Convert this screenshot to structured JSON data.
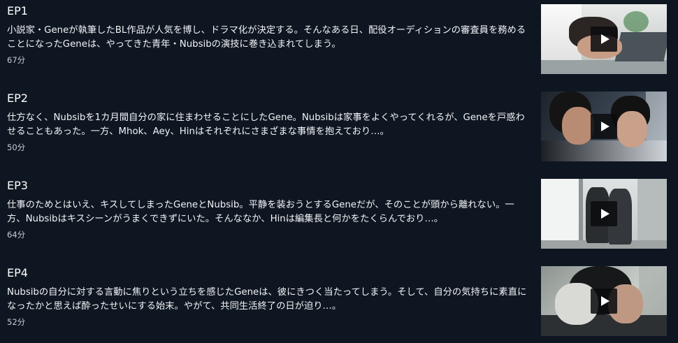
{
  "episodes": [
    {
      "title": "EP1",
      "description": "小説家・Geneが執筆したBL作品が人気を博し、ドラマ化が決定する。そんなある日、配役オーディションの審査員を務めることになったGeneは、やってきた青年・Nubsibの演技に巻き込まれてしまう。",
      "duration": "67分",
      "thumbnail_icon": "play-icon"
    },
    {
      "title": "EP2",
      "description": "仕方なく、Nubsibを1カ月間自分の家に住まわせることにしたGene。Nubsibは家事をよくやってくれるが、Geneを戸惑わせることもあった。一方、Mhok、Aey、Hinはそれぞれにさまざまな事情を抱えており…。",
      "duration": "50分",
      "thumbnail_icon": "play-icon"
    },
    {
      "title": "EP3",
      "description": "仕事のためとはいえ、キスしてしまったGeneとNubsib。平静を装おうとするGeneだが、そのことが頭から離れない。一方、Nubsibはキスシーンがうまくできずにいた。そんななか、Hinは編集長と何かをたくらんでおり…。",
      "duration": "64分",
      "thumbnail_icon": "play-icon"
    },
    {
      "title": "EP4",
      "description": "Nubsibの自分に対する言動に焦りという立ちを感じたGeneは、彼にきつく当たってしまう。そして、自分の気持ちに素直になったかと思えば酔ったせいにする始末。やがて、共同生活終了の日が迫り…。",
      "duration": "52分",
      "thumbnail_icon": "play-icon"
    }
  ],
  "colors": {
    "background": "#0e1621",
    "title_text": "#ffffff",
    "description_text": "#f2f4f7",
    "duration_text": "#c8ccd2",
    "play_button_bg": "#0a0c0e"
  }
}
